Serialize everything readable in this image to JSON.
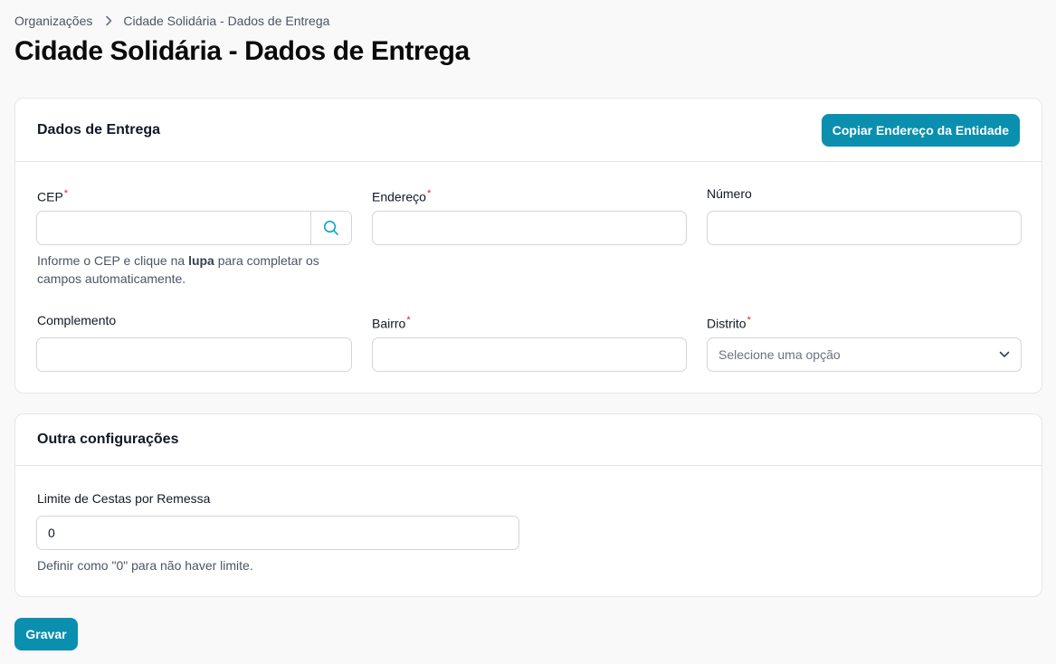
{
  "breadcrumb": {
    "parent": "Organizações",
    "current": "Cidade Solidária - Dados de Entrega"
  },
  "page_title": "Cidade Solidária - Dados de Entrega",
  "delivery": {
    "title": "Dados de Entrega",
    "copy_button": "Copiar Endereço da Entidade",
    "cep": {
      "label": "CEP",
      "value": "",
      "hint_prefix": "Informe o CEP e clique na ",
      "hint_bold": "lupa",
      "hint_suffix": " para completar os campos automaticamente."
    },
    "endereco": {
      "label": "Endereço",
      "value": ""
    },
    "numero": {
      "label": "Número",
      "value": ""
    },
    "complemento": {
      "label": "Complemento",
      "value": ""
    },
    "bairro": {
      "label": "Bairro",
      "value": ""
    },
    "distrito": {
      "label": "Distrito",
      "placeholder": "Selecione uma opção"
    },
    "required_mark": "*"
  },
  "other": {
    "title": "Outra configurações",
    "limit": {
      "label": "Limite de Cestas por Remessa",
      "value": "0",
      "hint": "Definir como \"0\" para não haver limite."
    }
  },
  "save_button": "Gravar",
  "icons": {
    "breadcrumb_separator": "chevron-right-icon",
    "cep_search": "search-icon",
    "select_arrow": "chevron-down-icon"
  },
  "colors": {
    "primary": "#0b8fae",
    "required": "#dc2626",
    "search_icon": "#0ea5c6"
  }
}
